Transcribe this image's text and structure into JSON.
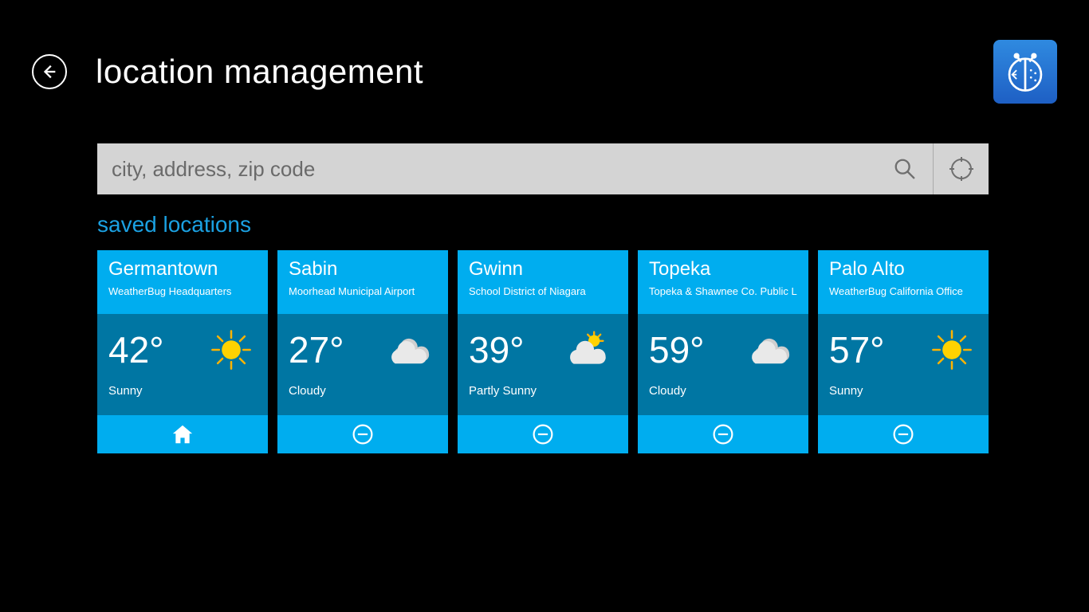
{
  "header": {
    "title": "location management"
  },
  "search": {
    "placeholder": "city, address, zip code"
  },
  "section_heading": "saved locations",
  "locations": [
    {
      "city": "Germantown",
      "station": "WeatherBug Headquarters",
      "temp": "42°",
      "condition": "Sunny",
      "icon": "sunny",
      "home": true
    },
    {
      "city": "Sabin",
      "station": "Moorhead Municipal Airport",
      "temp": "27°",
      "condition": "Cloudy",
      "icon": "cloudy",
      "home": false
    },
    {
      "city": "Gwinn",
      "station": "School District of Niagara",
      "temp": "39°",
      "condition": "Partly Sunny",
      "icon": "partly-sunny",
      "home": false
    },
    {
      "city": "Topeka",
      "station": "Topeka & Shawnee Co. Public L",
      "temp": "59°",
      "condition": "Cloudy",
      "icon": "cloudy",
      "home": false
    },
    {
      "city": "Palo Alto",
      "station": "WeatherBug California Office",
      "temp": "57°",
      "condition": "Sunny",
      "icon": "sunny",
      "home": false
    }
  ]
}
